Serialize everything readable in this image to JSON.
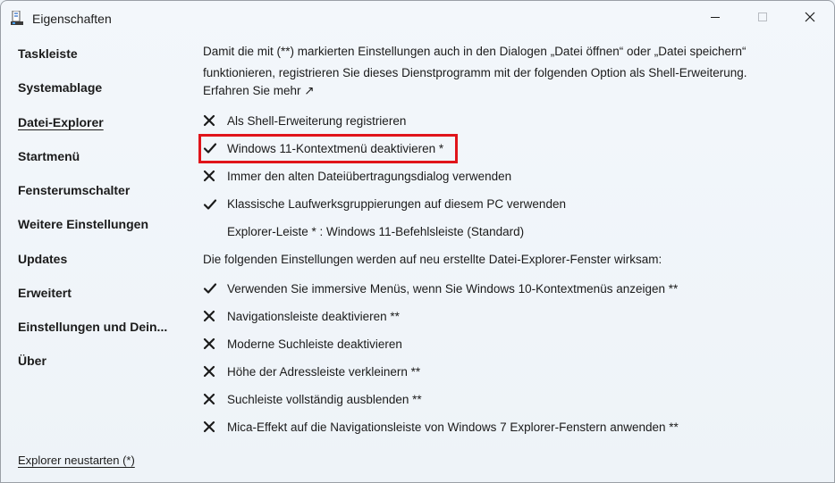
{
  "window": {
    "title": "Eigenschaften",
    "minimize_glyph": "—",
    "close_glyph": "✕",
    "highlight_color": "#e0141a"
  },
  "sidebar": {
    "items": [
      {
        "label": "Taskleiste"
      },
      {
        "label": "Systemablage"
      },
      {
        "label": "Datei-Explorer"
      },
      {
        "label": "Startmenü"
      },
      {
        "label": "Fensterumschalter"
      },
      {
        "label": "Weitere Einstellungen"
      },
      {
        "label": "Updates"
      },
      {
        "label": "Erweitert"
      },
      {
        "label": "Einstellungen und Dein..."
      },
      {
        "label": "Über"
      }
    ],
    "active_index": 2,
    "restart_label": "Explorer neustarten (*)"
  },
  "main": {
    "intro": "Damit die mit (**) markierten Einstellungen auch in den Dialogen „Datei öffnen“ oder „Datei speichern“ funktionieren, registrieren Sie dieses Dienstprogramm mit der folgenden Option als Shell-Erweiterung.",
    "learn_more": "Erfahren Sie mehr ↗",
    "options": [
      {
        "label": "Als Shell-Erweiterung registrieren",
        "state": "x"
      },
      {
        "label": "Windows 11-Kontextmenü deaktivieren *",
        "state": "check"
      },
      {
        "label": "Immer den alten Dateiübertragungsdialog verwenden",
        "state": "x"
      },
      {
        "label": "Klassische Laufwerksgruppierungen auf diesem PC verwenden",
        "state": "check"
      },
      {
        "label": "Explorer-Leiste * : Windows 11-Befehlsleiste (Standard)",
        "state": "none"
      }
    ],
    "section_note": "Die folgenden Einstellungen werden auf neu erstellte Datei-Explorer-Fenster wirksam:",
    "options2": [
      {
        "label": "Verwenden Sie immersive Menüs, wenn Sie Windows 10-Kontextmenüs anzeigen **",
        "state": "check"
      },
      {
        "label": "Navigationsleiste deaktivieren **",
        "state": "x"
      },
      {
        "label": "Moderne Suchleiste deaktivieren",
        "state": "x"
      },
      {
        "label": "Höhe der Adressleiste verkleinern **",
        "state": "x"
      },
      {
        "label": "Suchleiste vollständig ausblenden **",
        "state": "x"
      },
      {
        "label": "Mica-Effekt auf die Navigationsleiste von Windows 7 Explorer-Fenstern anwenden **",
        "state": "x"
      }
    ]
  }
}
